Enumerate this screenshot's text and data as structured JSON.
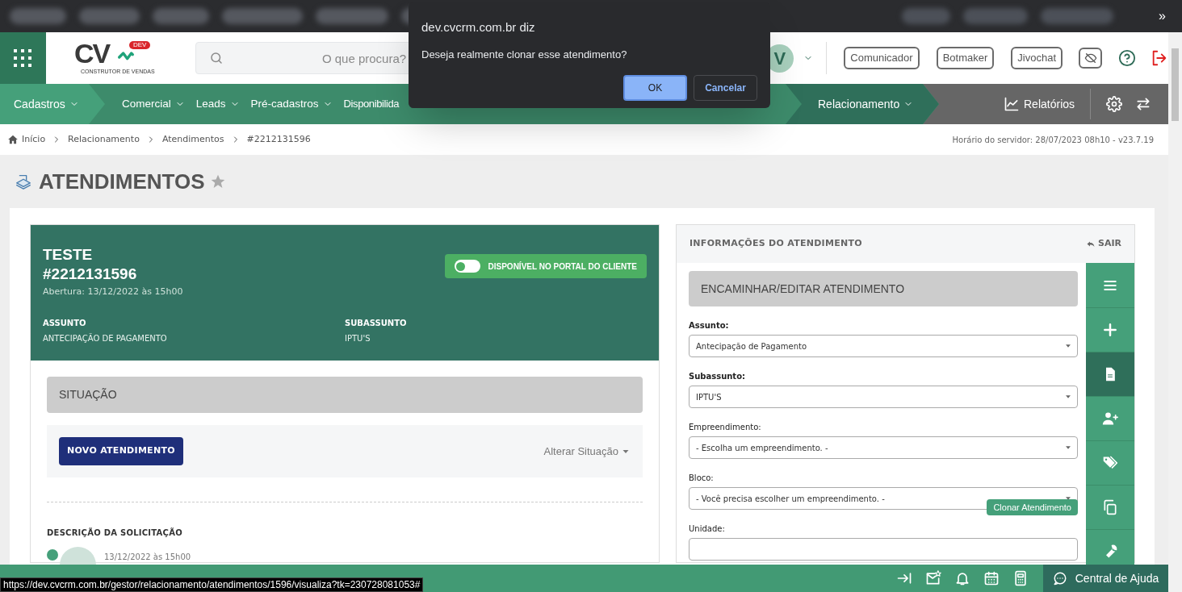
{
  "browser": {
    "overflow": "»"
  },
  "header": {
    "logo": {
      "mark": "CV",
      "badge": "DEV",
      "tagline": "CONSTRUTOR DE VENDAS"
    },
    "search": {
      "placeholder": "O que procura?"
    },
    "avatar": "V",
    "buttons": [
      "Comunicador",
      "Botmaker",
      "Jivochat"
    ]
  },
  "nav": {
    "items": [
      {
        "label": "Cadastros",
        "kind": "first"
      },
      {
        "label": "Comercial",
        "kind": "plain"
      },
      {
        "label": "Leads",
        "kind": "plain"
      },
      {
        "label": "Pré-cadastros",
        "kind": "plain"
      },
      {
        "label": "Disponibilida",
        "kind": "cut"
      },
      {
        "label": "Relacionamento",
        "kind": "active"
      }
    ],
    "reports": "Relatórios"
  },
  "breadcrumb": {
    "items": [
      "Início",
      "Relacionamento",
      "Atendimentos",
      "#2212131596"
    ],
    "server_time": "Horário do servidor: 28/07/2023 08h10 - v23.7.19"
  },
  "page_title": "ATENDIMENTOS",
  "ticket": {
    "name": "TESTE",
    "number": "#2212131596",
    "opened": "Abertura: 13/12/2022 às 15h00",
    "portal_toggle": {
      "label": "DISPONÍVEL NO PORTAL DO CLIENTE",
      "on": false
    },
    "fields": [
      {
        "label": "ASSUNTO",
        "value": "ANTECIPAÇÃO DE PAGAMENTO"
      },
      {
        "label": "SUBASSUNTO",
        "value": "IPTU'S"
      }
    ],
    "status_section": "SITUAÇÃO",
    "new_button": "NOVO ATENDIMENTO",
    "change_status": "Alterar Situação",
    "description_heading": "DESCRIÇÃO DA SOLICITAÇÃO",
    "entry_date": "13/12/2022 às 15h00"
  },
  "info_panel": {
    "title": "INFORMAÇÕES DO ATENDIMENTO",
    "exit": "SAIR",
    "section": "ENCAMINHAR/EDITAR ATENDIMENTO",
    "form": [
      {
        "label": "Assunto:",
        "required": true,
        "kind": "select",
        "value": "Antecipação de Pagamento"
      },
      {
        "label": "Subassunto:",
        "required": true,
        "kind": "select",
        "value": "IPTU'S"
      },
      {
        "label": "Empreendimento:",
        "required": false,
        "kind": "select",
        "value": "- Escolha um empreendimento. -"
      },
      {
        "label": "Bloco:",
        "required": false,
        "kind": "select",
        "value": "- Você precisa escolher um empreendimento. -"
      },
      {
        "label": "Unidade:",
        "required": false,
        "kind": "input"
      }
    ],
    "toolbar": [
      {
        "kind": "menu",
        "selected": false
      },
      {
        "kind": "plus",
        "selected": false
      },
      {
        "kind": "document",
        "selected": true
      },
      {
        "kind": "user-plus",
        "selected": false
      },
      {
        "kind": "tags",
        "selected": false
      },
      {
        "kind": "copy",
        "selected": false,
        "tooltip": "Clonar Atendimento"
      },
      {
        "kind": "wrench",
        "selected": false
      }
    ]
  },
  "footer": {
    "icons": [
      {
        "kind": "arrow-to-line"
      },
      {
        "kind": "mail-star"
      },
      {
        "kind": "bell"
      },
      {
        "kind": "calendar"
      },
      {
        "kind": "calculator"
      }
    ],
    "help": "Central de Ajuda"
  },
  "status_url": "https://dev.cvcrm.com.br/gestor/relacionamento/atendimentos/1596/visualiza?tk=230728081053#",
  "dialog": {
    "title": "dev.cvcrm.com.br diz",
    "message": "Deseja realmente clonar esse atendimento?",
    "buttons": [
      {
        "label": "OK",
        "kind": "primary"
      },
      {
        "label": "Cancelar",
        "kind": "secondary"
      }
    ]
  }
}
